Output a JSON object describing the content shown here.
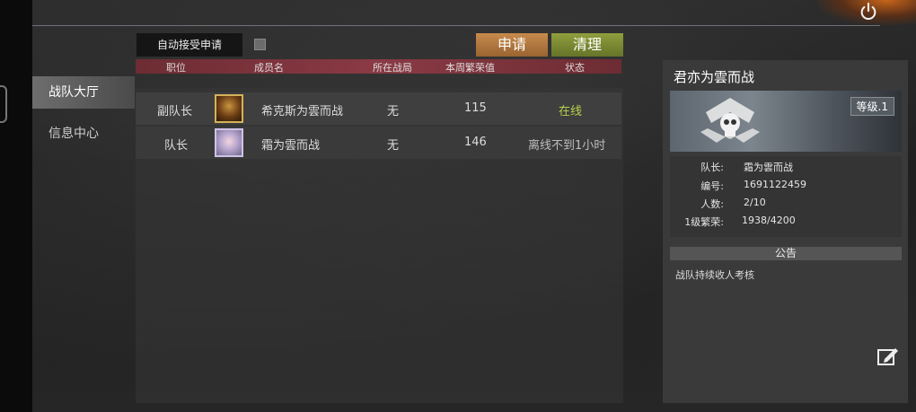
{
  "sidebar": {
    "items": [
      {
        "label": "战队大厅"
      },
      {
        "label": "信息中心"
      }
    ]
  },
  "toolbar": {
    "auto_accept_label": "自动接受申请",
    "apply_label": "申请",
    "clear_label": "清理"
  },
  "table": {
    "headers": [
      "职位",
      "成员名",
      "所在战局",
      "本周繁荣值",
      "状态"
    ],
    "rows": [
      {
        "position": "副队长",
        "name": "希克斯为雲而战",
        "battle": "无",
        "prosperity": "115",
        "status": "在线",
        "status_color": "#b6d14a"
      },
      {
        "position": "队长",
        "name": "霜为雲而战",
        "battle": "无",
        "prosperity": "146",
        "status": "离线不到1小时",
        "status_color": "#bdbdbd"
      }
    ]
  },
  "team": {
    "name": "君亦为雲而战",
    "level": "等级.1",
    "captain_label": "队长:",
    "captain": "霜为雲而战",
    "id_label": "编号:",
    "id": "1691122459",
    "members_label": "人数:",
    "members": "2/10",
    "prosperity_label": "1级繁荣:",
    "prosperity": "1938/4200",
    "notice_title": "公告",
    "notice_text": "战队持续收人考核"
  },
  "icons": {
    "power": "power-icon",
    "edit": "edit-icon",
    "emblem": "skull-emblem-icon"
  }
}
